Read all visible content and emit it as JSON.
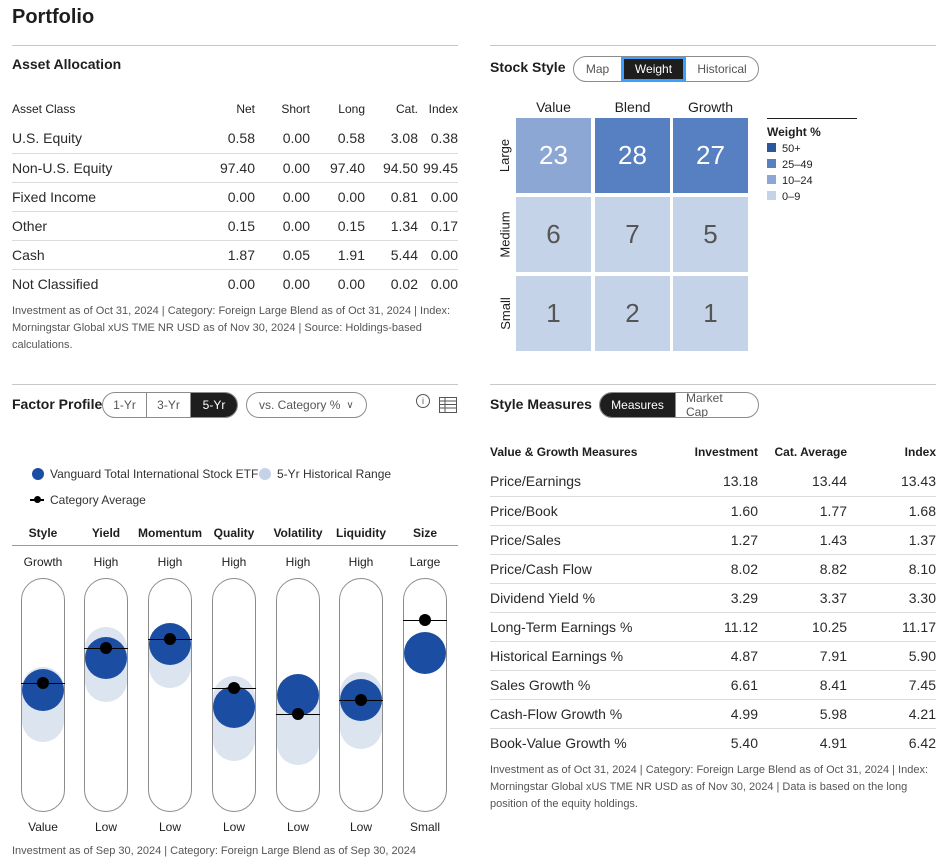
{
  "page_title": "Portfolio",
  "asset_allocation": {
    "title": "Asset Allocation",
    "headers": [
      "Asset Class",
      "Net",
      "Short",
      "Long",
      "Cat.",
      "Index"
    ],
    "rows": [
      [
        "U.S. Equity",
        "0.58",
        "0.00",
        "0.58",
        "3.08",
        "0.38"
      ],
      [
        "Non-U.S. Equity",
        "97.40",
        "0.00",
        "97.40",
        "94.50",
        "99.45"
      ],
      [
        "Fixed Income",
        "0.00",
        "0.00",
        "0.00",
        "0.81",
        "0.00"
      ],
      [
        "Other",
        "0.15",
        "0.00",
        "0.15",
        "1.34",
        "0.17"
      ],
      [
        "Cash",
        "1.87",
        "0.05",
        "1.91",
        "5.44",
        "0.00"
      ],
      [
        "Not Classified",
        "0.00",
        "0.00",
        "0.00",
        "0.02",
        "0.00"
      ]
    ],
    "footnote": "Investment as of Oct 31, 2024 | Category: Foreign Large Blend as of Oct 31, 2024 | Index: Morningstar Global xUS TME NR USD as of Nov 30, 2024 | Source: Holdings-based calculations."
  },
  "stock_style": {
    "title": "Stock Style",
    "tabs": [
      "Map",
      "Weight",
      "Historical"
    ],
    "active_tab": "Weight",
    "columns": [
      "Value",
      "Blend",
      "Growth"
    ],
    "rows": [
      "Large",
      "Medium",
      "Small"
    ],
    "values": [
      [
        "23",
        "28",
        "27"
      ],
      [
        "6",
        "7",
        "5"
      ],
      [
        "1",
        "2",
        "1"
      ]
    ],
    "legend_title": "Weight %",
    "legend": [
      {
        "label": "50+",
        "color": "#2b579f"
      },
      {
        "label": "25–49",
        "color": "#5680c1"
      },
      {
        "label": "10–24",
        "color": "#8ca7d3"
      },
      {
        "label": "0–9",
        "color": "#c5d3e8"
      }
    ]
  },
  "factor_profile": {
    "title": "Factor Profile",
    "periods": [
      "1-Yr",
      "3-Yr",
      "5-Yr"
    ],
    "active_period": "5-Yr",
    "compare_label": "vs. Category %",
    "legend": {
      "fund": "Vanguard Total International Stock ETF",
      "range": "5-Yr Historical Range",
      "category": "Category Average"
    },
    "factors": [
      {
        "name": "Style",
        "top": "Growth",
        "bottom": "Value",
        "fund": 0.52,
        "category": 0.55,
        "range": [
          0.3,
          0.62
        ]
      },
      {
        "name": "Yield",
        "top": "High",
        "bottom": "Low",
        "fund": 0.66,
        "category": 0.7,
        "range": [
          0.47,
          0.79
        ]
      },
      {
        "name": "Momentum",
        "top": "High",
        "bottom": "Low",
        "fund": 0.72,
        "category": 0.74,
        "range": [
          0.53,
          0.8
        ]
      },
      {
        "name": "Quality",
        "top": "High",
        "bottom": "Low",
        "fund": 0.45,
        "category": 0.53,
        "range": [
          0.22,
          0.58
        ]
      },
      {
        "name": "Volatility",
        "top": "High",
        "bottom": "Low",
        "fund": 0.5,
        "category": 0.42,
        "range": [
          0.2,
          0.58
        ]
      },
      {
        "name": "Liquidity",
        "top": "High",
        "bottom": "Low",
        "fund": 0.48,
        "category": 0.48,
        "range": [
          0.27,
          0.6
        ]
      },
      {
        "name": "Size",
        "top": "Large",
        "bottom": "Small",
        "fund": 0.68,
        "category": 0.82,
        "range": [
          0.62,
          0.7
        ]
      }
    ],
    "footnote": "Investment as of Sep 30, 2024 | Category: Foreign Large Blend as of Sep 30, 2024"
  },
  "style_measures": {
    "title": "Style Measures",
    "tabs": [
      "Measures",
      "Market Cap"
    ],
    "active_tab": "Measures",
    "headers": [
      "Value & Growth Measures",
      "Investment",
      "Cat. Average",
      "Index"
    ],
    "rows": [
      [
        "Price/Earnings",
        "13.18",
        "13.44",
        "13.43"
      ],
      [
        "Price/Book",
        "1.60",
        "1.77",
        "1.68"
      ],
      [
        "Price/Sales",
        "1.27",
        "1.43",
        "1.37"
      ],
      [
        "Price/Cash Flow",
        "8.02",
        "8.82",
        "8.10"
      ],
      [
        "Dividend Yield %",
        "3.29",
        "3.37",
        "3.30"
      ],
      [
        "Long-Term Earnings %",
        "11.12",
        "10.25",
        "11.17"
      ],
      [
        "Historical Earnings %",
        "4.87",
        "7.91",
        "5.90"
      ],
      [
        "Sales Growth %",
        "6.61",
        "8.41",
        "7.45"
      ],
      [
        "Cash-Flow Growth %",
        "4.99",
        "5.98",
        "4.21"
      ],
      [
        "Book-Value Growth %",
        "5.40",
        "4.91",
        "6.42"
      ]
    ],
    "footnote": "Investment as of Oct 31, 2024 | Category: Foreign Large Blend as of Oct 31, 2024 | Index: Morningstar Global xUS TME NR USD as of Nov 30, 2024 | Data is based on the long position of the equity holdings."
  },
  "colors": {
    "fund_dot": "#1b4ea3",
    "range": "#dce4f0",
    "category": "#000000"
  }
}
